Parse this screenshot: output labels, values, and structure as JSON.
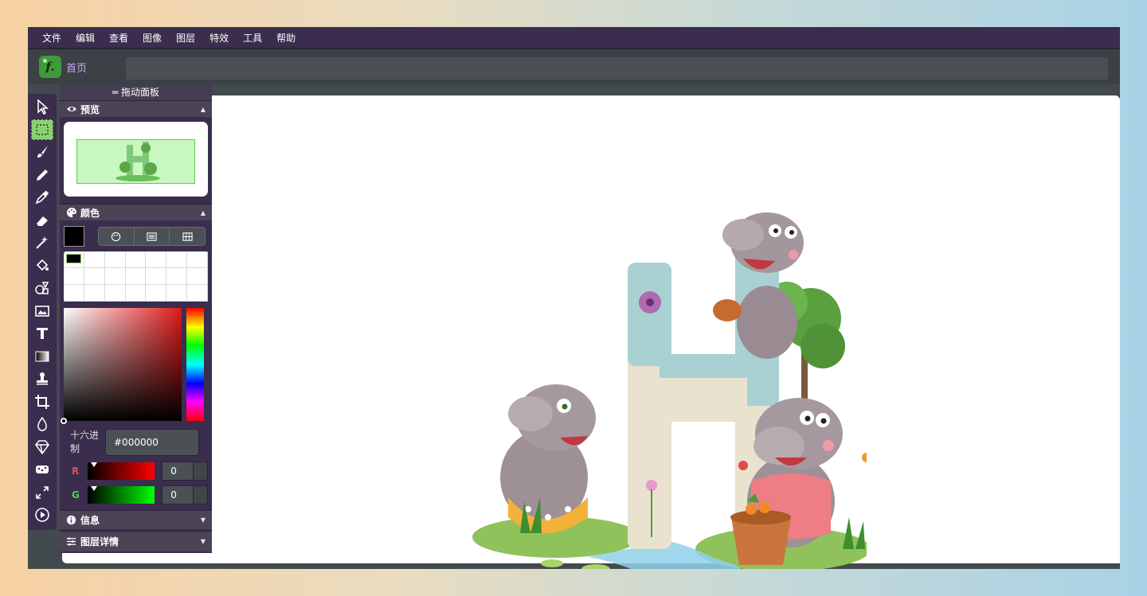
{
  "menu": [
    "文件",
    "编辑",
    "查看",
    "图像",
    "图层",
    "特效",
    "工具",
    "帮助"
  ],
  "tabs": {
    "home_label": "首页"
  },
  "panel": {
    "drag_label": "═ 拖动面板",
    "preview_title": "预览",
    "color_title": "颜色",
    "hex_label": "十六进制",
    "hex_value": "#000000",
    "channels": [
      {
        "label": "R",
        "value": "0",
        "color": "#e05050"
      },
      {
        "label": "G",
        "value": "0",
        "color": "#50d050"
      }
    ],
    "info_title": "信息",
    "layer_details_title": "图层详情"
  },
  "colors": {
    "menubar": "#3a2d4d",
    "accent_green": "#8bd173",
    "home_label": "#c9a8f0",
    "canvas": "#ffffff"
  },
  "tools": [
    "select-pointer-icon",
    "marquee-select-icon",
    "brush-icon",
    "pencil-icon",
    "eyedropper-icon",
    "eraser-icon",
    "magic-wand-icon",
    "fill-bucket-icon",
    "shapes-icon",
    "image-icon",
    "text-icon",
    "gradient-icon",
    "stamp-icon",
    "crop-icon",
    "blur-drop-icon",
    "sharpen-icon",
    "sponge-icon",
    "resize-icon",
    "play-icon"
  ]
}
